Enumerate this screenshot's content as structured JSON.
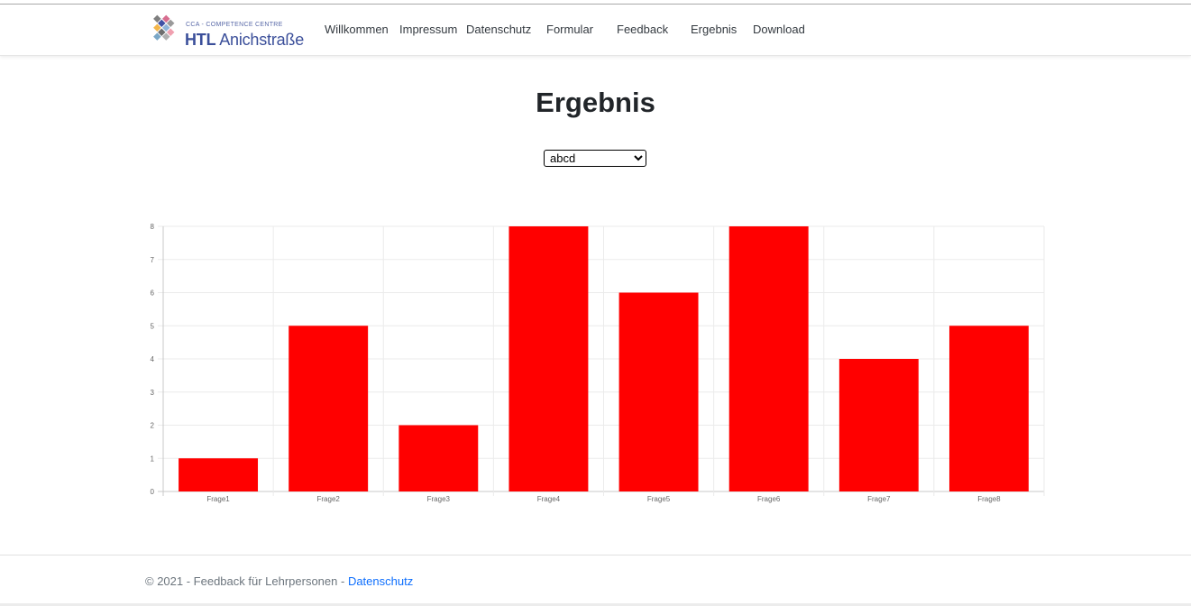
{
  "header": {
    "logo_small": "CCA - COMPETENCE CENTRE",
    "logo_htl": "HTL",
    "logo_name": "Anichstraße",
    "nav": [
      {
        "label": "Willkommen"
      },
      {
        "label": "Impressum"
      },
      {
        "label": "Datenschutz"
      },
      {
        "label": "Formular"
      },
      {
        "label": "Feedback"
      },
      {
        "label": "Ergebnis"
      },
      {
        "label": "Download"
      }
    ]
  },
  "main": {
    "title": "Ergebnis",
    "select": {
      "selected": "abcd"
    }
  },
  "chart_data": {
    "type": "bar",
    "categories": [
      "Frage1",
      "Frage2",
      "Frage3",
      "Frage4",
      "Frage5",
      "Frage6",
      "Frage7",
      "Frage8"
    ],
    "values": [
      1,
      5,
      2,
      8,
      6,
      8,
      4,
      5
    ],
    "ylim": [
      0,
      8
    ],
    "yticks": [
      0,
      1,
      2,
      3,
      4,
      5,
      6,
      7,
      8
    ],
    "bar_color": "#ff0000",
    "grid": true
  },
  "footer": {
    "text": "© 2021 - Feedback für Lehrpersonen - ",
    "link": "Datenschutz"
  },
  "colors": {
    "nav_text": "#343a40",
    "link": "#0d6efd",
    "logo": "#3b4f9a"
  }
}
